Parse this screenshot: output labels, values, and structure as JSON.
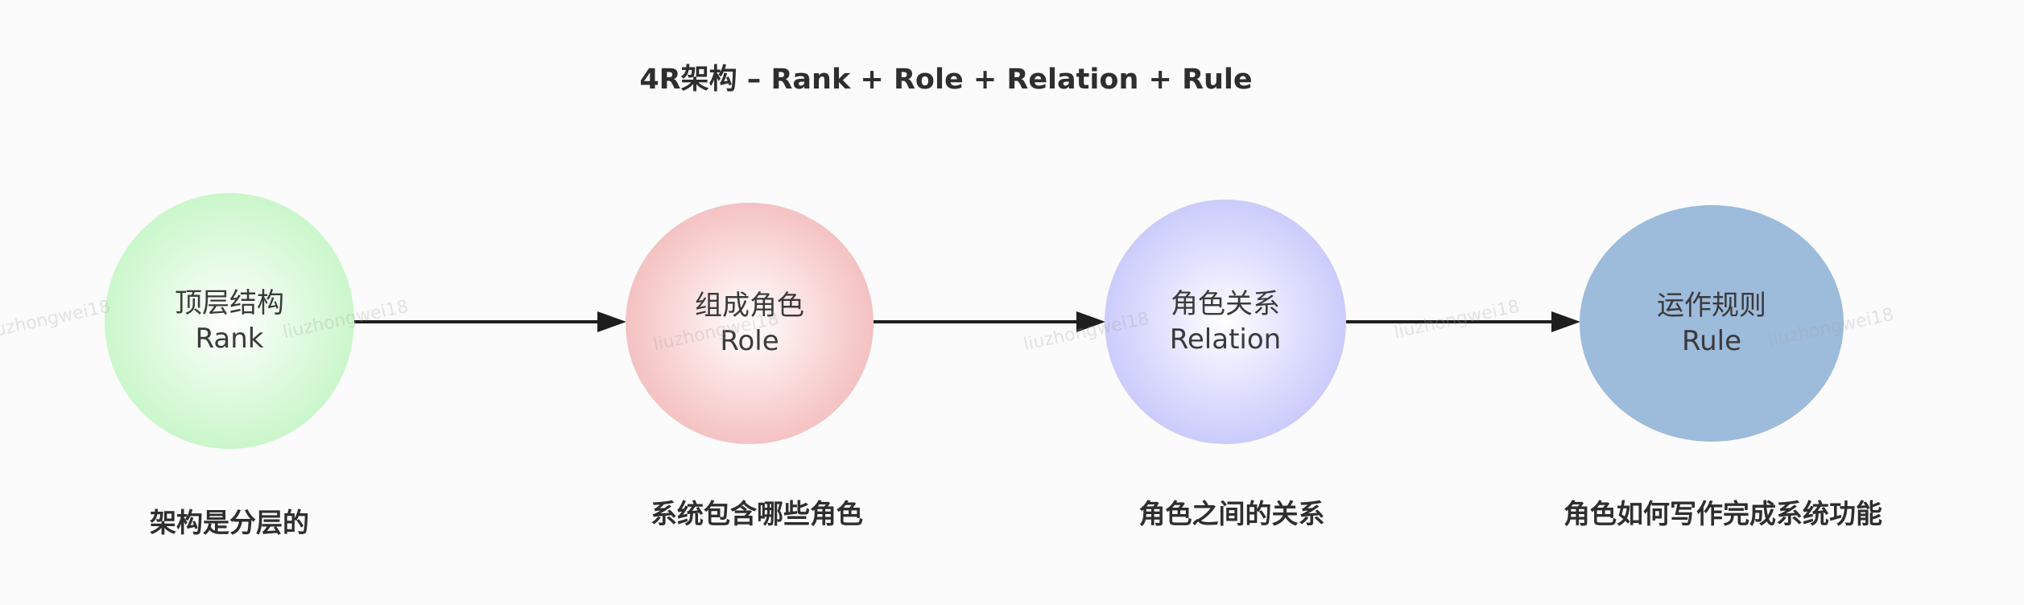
{
  "title": "4R架构 – Rank + Role + Relation + Rule",
  "nodes": [
    {
      "label_cn": "顶层结构",
      "label_en": "Rank",
      "caption": "架构是分层的",
      "color": "#b6f3b6"
    },
    {
      "label_cn": "组成角色",
      "label_en": "Role",
      "caption": "系统包含哪些角色",
      "color": "#efa9a9"
    },
    {
      "label_cn": "角色关系",
      "label_en": "Relation",
      "caption": "角色之间的关系",
      "color": "#b8b8f8"
    },
    {
      "label_cn": "运作规则",
      "label_en": "Rule",
      "caption": "角色如何写作完成系统功能",
      "color": "#9dbbdb"
    }
  ],
  "watermark": "liuzhongwei18"
}
